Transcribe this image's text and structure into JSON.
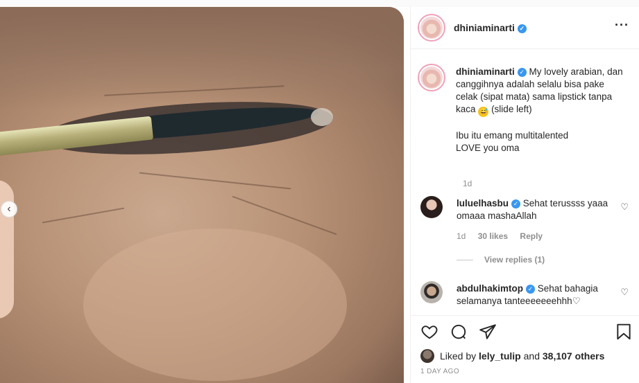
{
  "post": {
    "username": "dhiniaminarti",
    "more_icon": "more-horizontal-icon",
    "caption": {
      "username": "dhiniaminarti",
      "text": "My lovely arabian, dan canggihnya adalah selalu bisa pake celak (sipat mata) sama lipstick tanpa kaca",
      "emoji": "grinning-sweat-emoji",
      "text_after": "(slide left)",
      "line2": "Ibu itu emang multitalented",
      "line3": "LOVE you oma",
      "time": "1d"
    },
    "comments": [
      {
        "username": "luluelhasbu",
        "text": "Sehat terussss yaaa omaaa mashaAllah",
        "time": "1d",
        "likes": "30 likes",
        "reply": "Reply",
        "view_replies": "View replies (1)"
      },
      {
        "username": "abdulhakimtop",
        "text": "Sehat bahagia selamanya tanteeeeeeehhh♡"
      }
    ],
    "likes": {
      "prefix": "Liked by",
      "user": "lely_tulip",
      "and": "and",
      "others": "38,107 others"
    },
    "posted": "1 DAY AGO"
  },
  "colors": {
    "verified": "#3897f0",
    "muted": "#8e8e8e",
    "text": "#262626"
  }
}
